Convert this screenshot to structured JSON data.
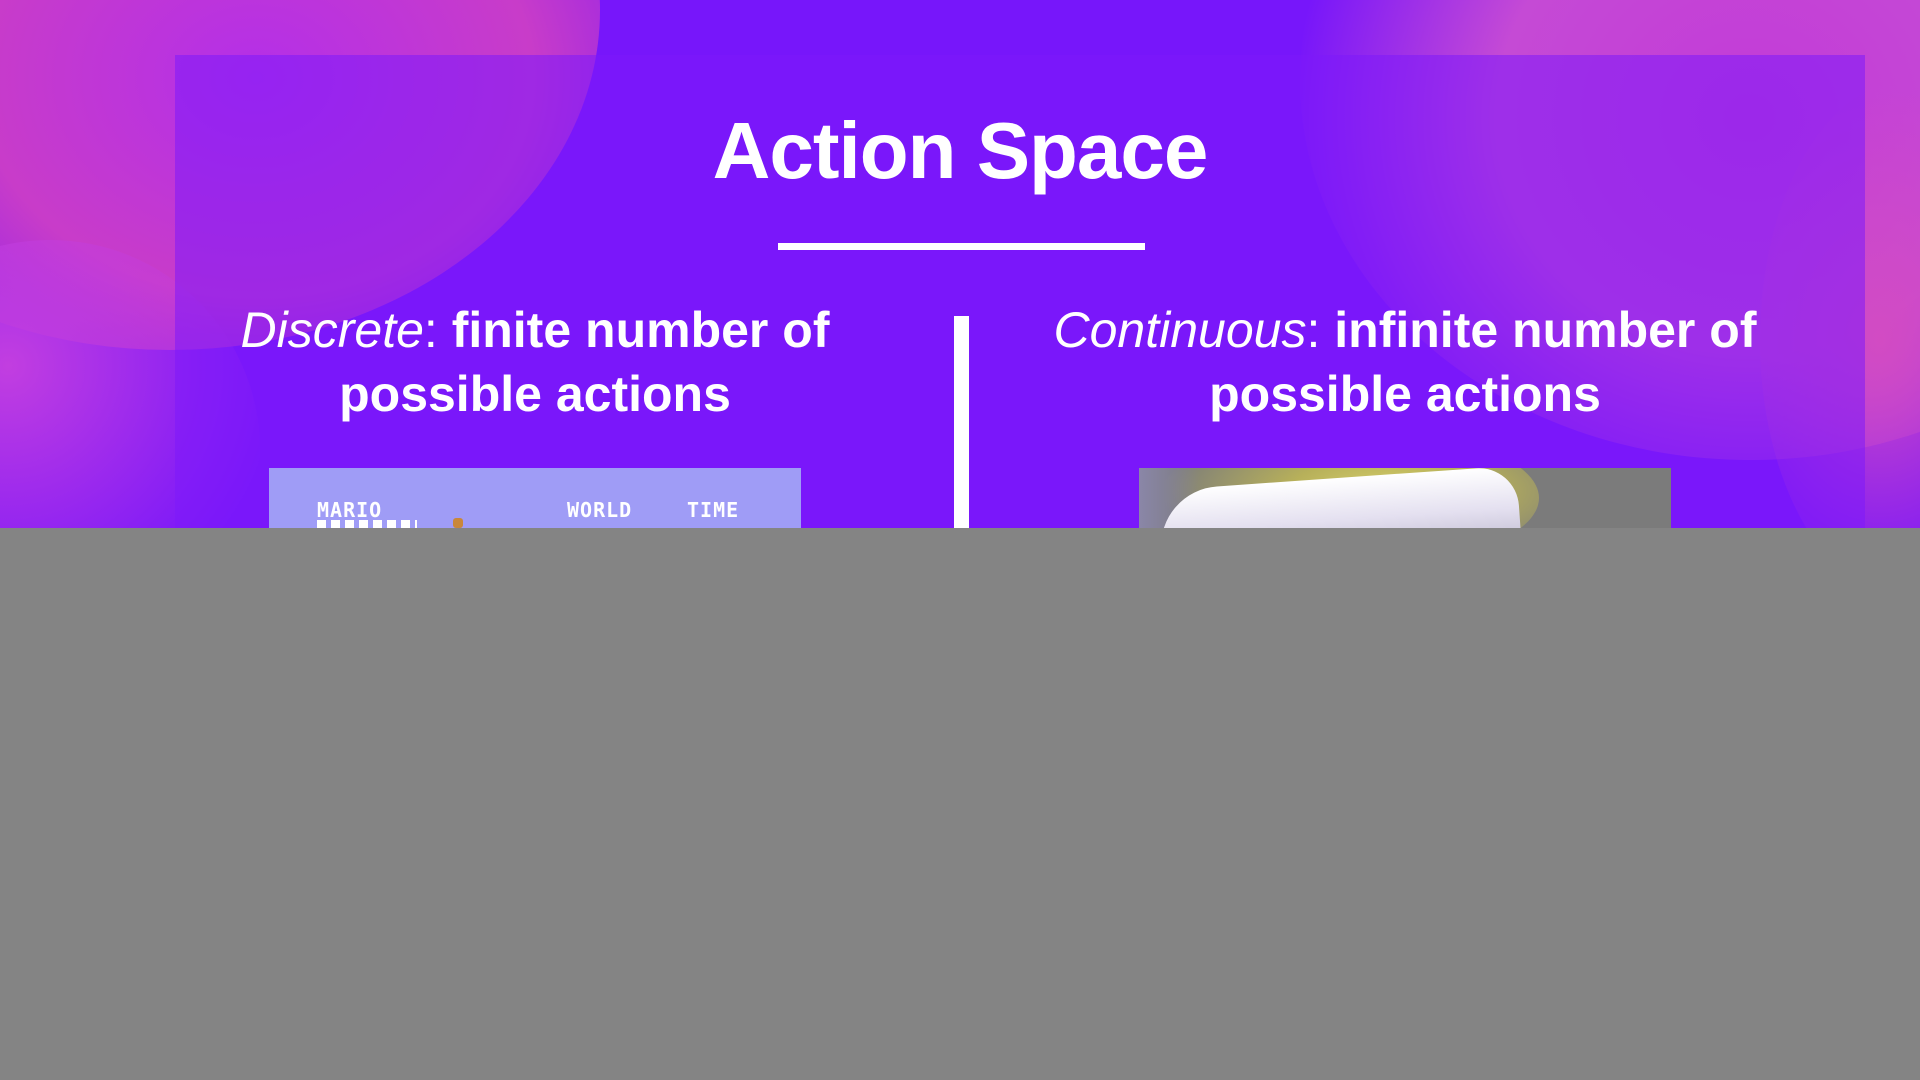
{
  "slide": {
    "title": "Action Space",
    "left": {
      "term": "Discrete",
      "colon": ":",
      "description": " finite number of possible actions",
      "image": {
        "hud_player": "MARIO",
        "hud_world": "WORLD",
        "hud_time": "TIME"
      }
    },
    "right": {
      "term": "Continuous",
      "colon": ":",
      "description": " infinite number of possible actions"
    }
  },
  "colors": {
    "background": "#7716fa",
    "accent_pink": "#c83cc9",
    "text": "#ffffff",
    "lower_area": "#848484"
  }
}
